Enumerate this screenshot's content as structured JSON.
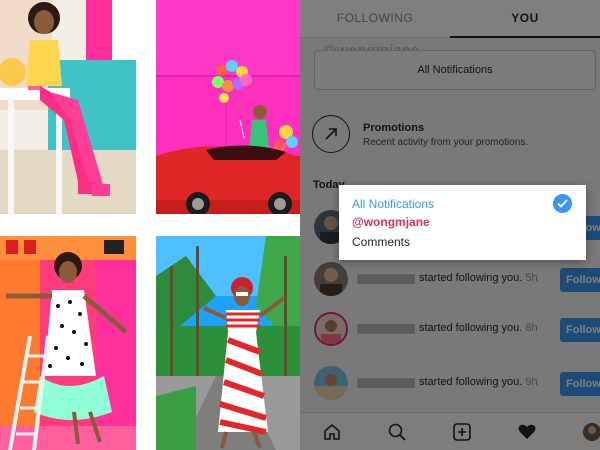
{
  "photos": [
    {
      "subject": "woman in yellow dress sitting at cafe table with pink boots"
    },
    {
      "subject": "woman with colorful balloons by red car and pink wall"
    },
    {
      "subject": "woman in polka dot dress with mint tulle on a ladder"
    },
    {
      "subject": "woman in red and white striped outfit on palm tree street"
    }
  ],
  "activity": {
    "tabs": [
      {
        "label": "FOLLOWING",
        "active": false
      },
      {
        "label": "YOU",
        "active": true
      }
    ],
    "filter": {
      "handle": "@wongmjane",
      "selected_label": "All Notifications"
    },
    "promotions": {
      "title": "Promotions",
      "subtitle": "Recent activity from your promotions."
    },
    "section": "Today",
    "rows": [
      {
        "text": "started following you.",
        "time": "5h",
        "button": "Follow"
      },
      {
        "text": "started following you.",
        "time": "8h",
        "button": "Follow"
      },
      {
        "text": "started following you.",
        "time": "9h",
        "button": "Follow"
      }
    ],
    "bottom_nav": [
      "home-icon",
      "search-icon",
      "add-post-icon",
      "heart-icon",
      "profile-icon"
    ]
  },
  "dropdown": {
    "options": [
      {
        "label": "All Notifications",
        "selected": true
      },
      {
        "label": "@wongmjane",
        "selected": false
      },
      {
        "label": "Comments",
        "selected": false
      }
    ]
  },
  "colors": {
    "accent_blue": "#3897f0",
    "handle_pink": "#d92f6a",
    "follow_blue": "#3897f0"
  }
}
